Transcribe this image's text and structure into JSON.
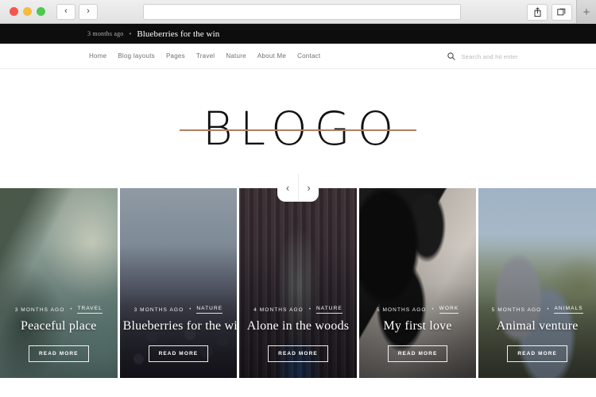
{
  "browser": {
    "traffic_lights": [
      "close",
      "minimize",
      "zoom"
    ],
    "back_label": "‹",
    "forward_label": "›",
    "url_value": "",
    "url_placeholder": "",
    "share_icon": "share-icon",
    "tabs_icon": "tabs-icon",
    "newtab_label": "+"
  },
  "ticker": {
    "time": "3 months ago",
    "separator": "•",
    "title": "Blueberries for the win"
  },
  "nav": {
    "items": [
      {
        "label": "Home"
      },
      {
        "label": "Blog layouts"
      },
      {
        "label": "Pages"
      },
      {
        "label": "Travel"
      },
      {
        "label": "Nature"
      },
      {
        "label": "About Me"
      },
      {
        "label": "Contact"
      }
    ]
  },
  "search": {
    "icon": "search-icon",
    "placeholder": "Search and hit enter"
  },
  "logo": {
    "text": "BLOGO",
    "rule_color": "#b07f63"
  },
  "carousel": {
    "prev_label": "‹",
    "next_label": "›"
  },
  "cards": [
    {
      "date": "3 Months Ago",
      "separator": "•",
      "category": "Travel",
      "title": "Peaceful place",
      "button": "Read More",
      "image": "mountain-cliff-photo"
    },
    {
      "date": "3 Months Ago",
      "separator": "•",
      "category": "Nature",
      "title": "Blueberries for the win",
      "button": "Read More",
      "image": "blueberries-photo"
    },
    {
      "date": "4 Months Ago",
      "separator": "•",
      "category": "Nature",
      "title": "Alone in the woods",
      "button": "Read More",
      "image": "forest-person-photo"
    },
    {
      "date": "5 Months Ago",
      "separator": "•",
      "category": "Work",
      "title": "My first love",
      "button": "Read More",
      "image": "vintage-camera-photo"
    },
    {
      "date": "5 Months Ago",
      "separator": "•",
      "category": "Animals",
      "title": "Animal venture",
      "button": "Read More",
      "image": "bull-hillside-photo"
    }
  ]
}
